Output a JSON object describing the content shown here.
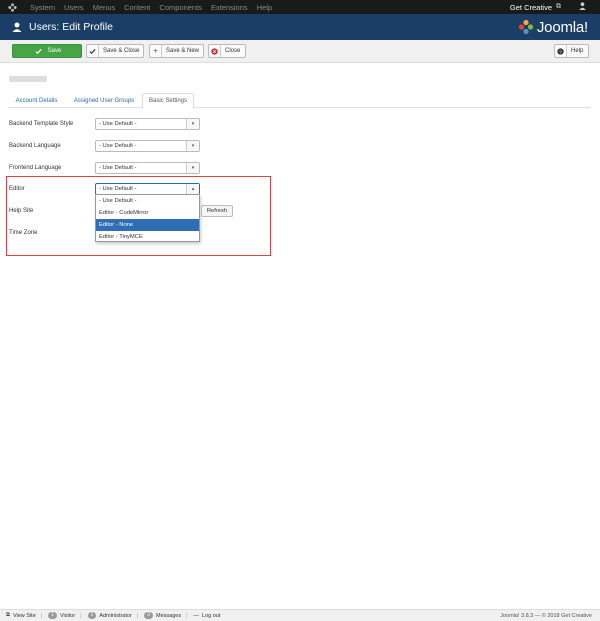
{
  "topnav": {
    "menu": [
      "System",
      "Users",
      "Menus",
      "Content",
      "Components",
      "Extensions",
      "Help"
    ],
    "site_name": "Get Creative",
    "external_icon": "external-link-icon",
    "user_icon": "user-icon"
  },
  "titlebar": {
    "title": "Users: Edit Profile",
    "brand": "Joomla!"
  },
  "toolbar": {
    "save": "Save",
    "save_close": "Save & Close",
    "save_new": "Save & New",
    "close": "Close",
    "help": "Help"
  },
  "tabs": [
    "Account Details",
    "Assigned User Groups",
    "Basic Settings"
  ],
  "fields": {
    "backend_template_label": "Backend Template Style",
    "backend_template_value": "- Use Default -",
    "backend_language_label": "Backend Language",
    "backend_language_value": "- Use Default -",
    "frontend_language_label": "Frontend Language",
    "frontend_language_value": "- Use Default -",
    "editor_label": "Editor",
    "editor_value": "- Use Default -",
    "help_site_label": "Help Site",
    "refresh": "Refresh",
    "time_zone_label": "Time Zone"
  },
  "editor_options": [
    "- Use Default -",
    "Editor - CodeMirror",
    "Editor - None",
    "Editor - TinyMCE"
  ],
  "editor_highlighted": "Editor - None",
  "status": {
    "view_site": "View Site",
    "visitor_count": "1",
    "visitor": "Visitor",
    "admin_count": "1",
    "administrator": "Administrator",
    "messages_count": "0",
    "messages": "Messages",
    "logout": "Log out",
    "version": "Joomla! 3.8.3 — © 2018 Get Creative"
  },
  "colors": {
    "topnav": "#1a1a1a",
    "titlebar": "#1b3e67",
    "save_green": "#46a546",
    "selected_blue": "#2f6db5",
    "highlight_red": "#e04141"
  }
}
